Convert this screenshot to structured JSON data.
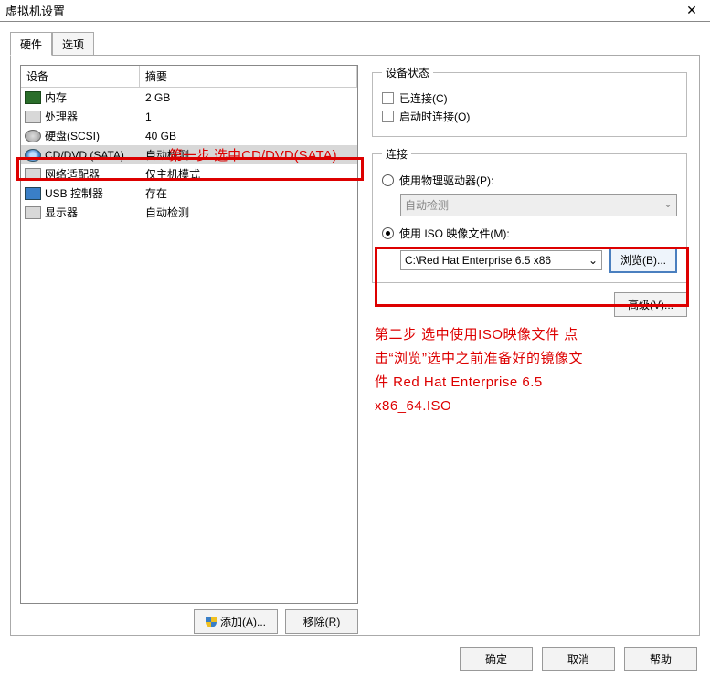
{
  "window": {
    "title": "虚拟机设置",
    "close_glyph": "✕"
  },
  "tabs": {
    "hardware": "硬件",
    "options": "选项"
  },
  "list": {
    "head_device": "设备",
    "head_summary": "摘要",
    "rows": [
      {
        "name": "内存",
        "summary": "2 GB",
        "icon": "ic-mem"
      },
      {
        "name": "处理器",
        "summary": "1",
        "icon": "ic-cpu"
      },
      {
        "name": "硬盘(SCSI)",
        "summary": "40 GB",
        "icon": "ic-hdd"
      },
      {
        "name": "CD/DVD (SATA)",
        "summary": "自动检测",
        "icon": "ic-cd",
        "selected": true
      },
      {
        "name": "网络适配器",
        "summary": "仅主机模式",
        "icon": "ic-net"
      },
      {
        "name": "USB 控制器",
        "summary": "存在",
        "icon": "ic-usb"
      },
      {
        "name": "显示器",
        "summary": "自动检测",
        "icon": "ic-mon"
      }
    ],
    "add_btn": "添加(A)...",
    "remove_btn": "移除(R)"
  },
  "status": {
    "legend": "设备状态",
    "connected": "已连接(C)",
    "connect_at_power": "启动时连接(O)"
  },
  "connection": {
    "legend": "连接",
    "physical": "使用物理驱动器(P):",
    "physical_value": "自动检测",
    "iso_label": "使用 ISO 映像文件(M):",
    "iso_path": "C:\\Red Hat Enterprise 6.5 x86",
    "browse": "浏览(B)...",
    "dropdown_glyph": "⌄"
  },
  "advanced_btn": "高级(V)...",
  "annotations": {
    "step1": "第一步 选中CD/DVD(SATA)",
    "step2": "第二步 选中使用ISO映像文件 点击“浏览”选中之前准备好的镜像文件 Red Hat Enterprise 6.5 x86_64.ISO"
  },
  "footer": {
    "ok": "确定",
    "cancel": "取消",
    "help": "帮助"
  }
}
